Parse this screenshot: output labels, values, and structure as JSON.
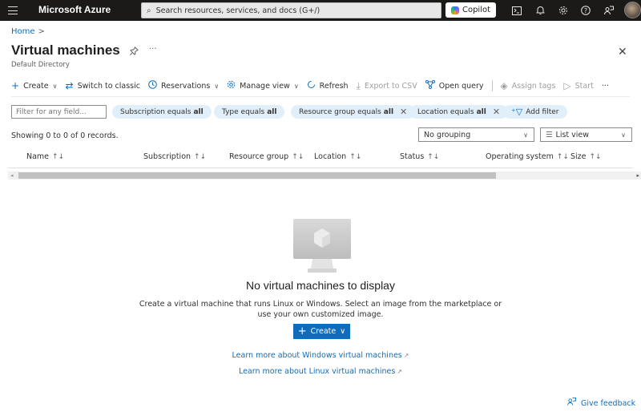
{
  "topbar": {
    "brand": "Microsoft Azure",
    "search_placeholder": "Search resources, services, and docs (G+/)",
    "copilot_label": "Copilot",
    "icons": [
      "menu-icon",
      "cloud-shell-icon",
      "notifications-icon",
      "settings-icon",
      "help-icon",
      "feedback-icon",
      "avatar"
    ]
  },
  "breadcrumb": {
    "home": "Home",
    "sep": ">"
  },
  "page": {
    "title": "Virtual machines",
    "subtitle": "Default Directory",
    "more": "···",
    "close": "✕"
  },
  "toolbar": {
    "create": "Create",
    "switch_classic": "Switch to classic",
    "reservations": "Reservations",
    "manage_view": "Manage view",
    "refresh": "Refresh",
    "export_csv": "Export to CSV",
    "open_query": "Open query",
    "assign_tags": "Assign tags",
    "start": "Start",
    "more": "···"
  },
  "filters": {
    "placeholder": "Filter for any field...",
    "pills": [
      {
        "label": "Subscription equals",
        "value": "all"
      },
      {
        "label": "Type equals",
        "value": "all"
      },
      {
        "label": "Resource group equals",
        "value": "all"
      },
      {
        "label": "Location equals",
        "value": "all"
      }
    ],
    "add_filter": "Add filter"
  },
  "records": {
    "showing": "Showing 0 to 0 of 0 records.",
    "grouping": "No grouping",
    "view": "List view"
  },
  "table": {
    "columns": [
      "Name",
      "Subscription",
      "Resource group",
      "Location",
      "Status",
      "Operating system",
      "Size"
    ],
    "sort_icon": "↑↓"
  },
  "empty_state": {
    "title": "No virtual machines to display",
    "description": "Create a virtual machine that runs Linux or Windows. Select an image from the marketplace or use your own customized image.",
    "create": "Create",
    "link_windows": "Learn more about Windows virtual machines",
    "link_linux": "Learn more about Linux virtual machines"
  },
  "feedback": "Give feedback",
  "colors": {
    "accent": "#0f6cbd",
    "topbar": "#1b1a19",
    "pill": "#e1effa"
  }
}
